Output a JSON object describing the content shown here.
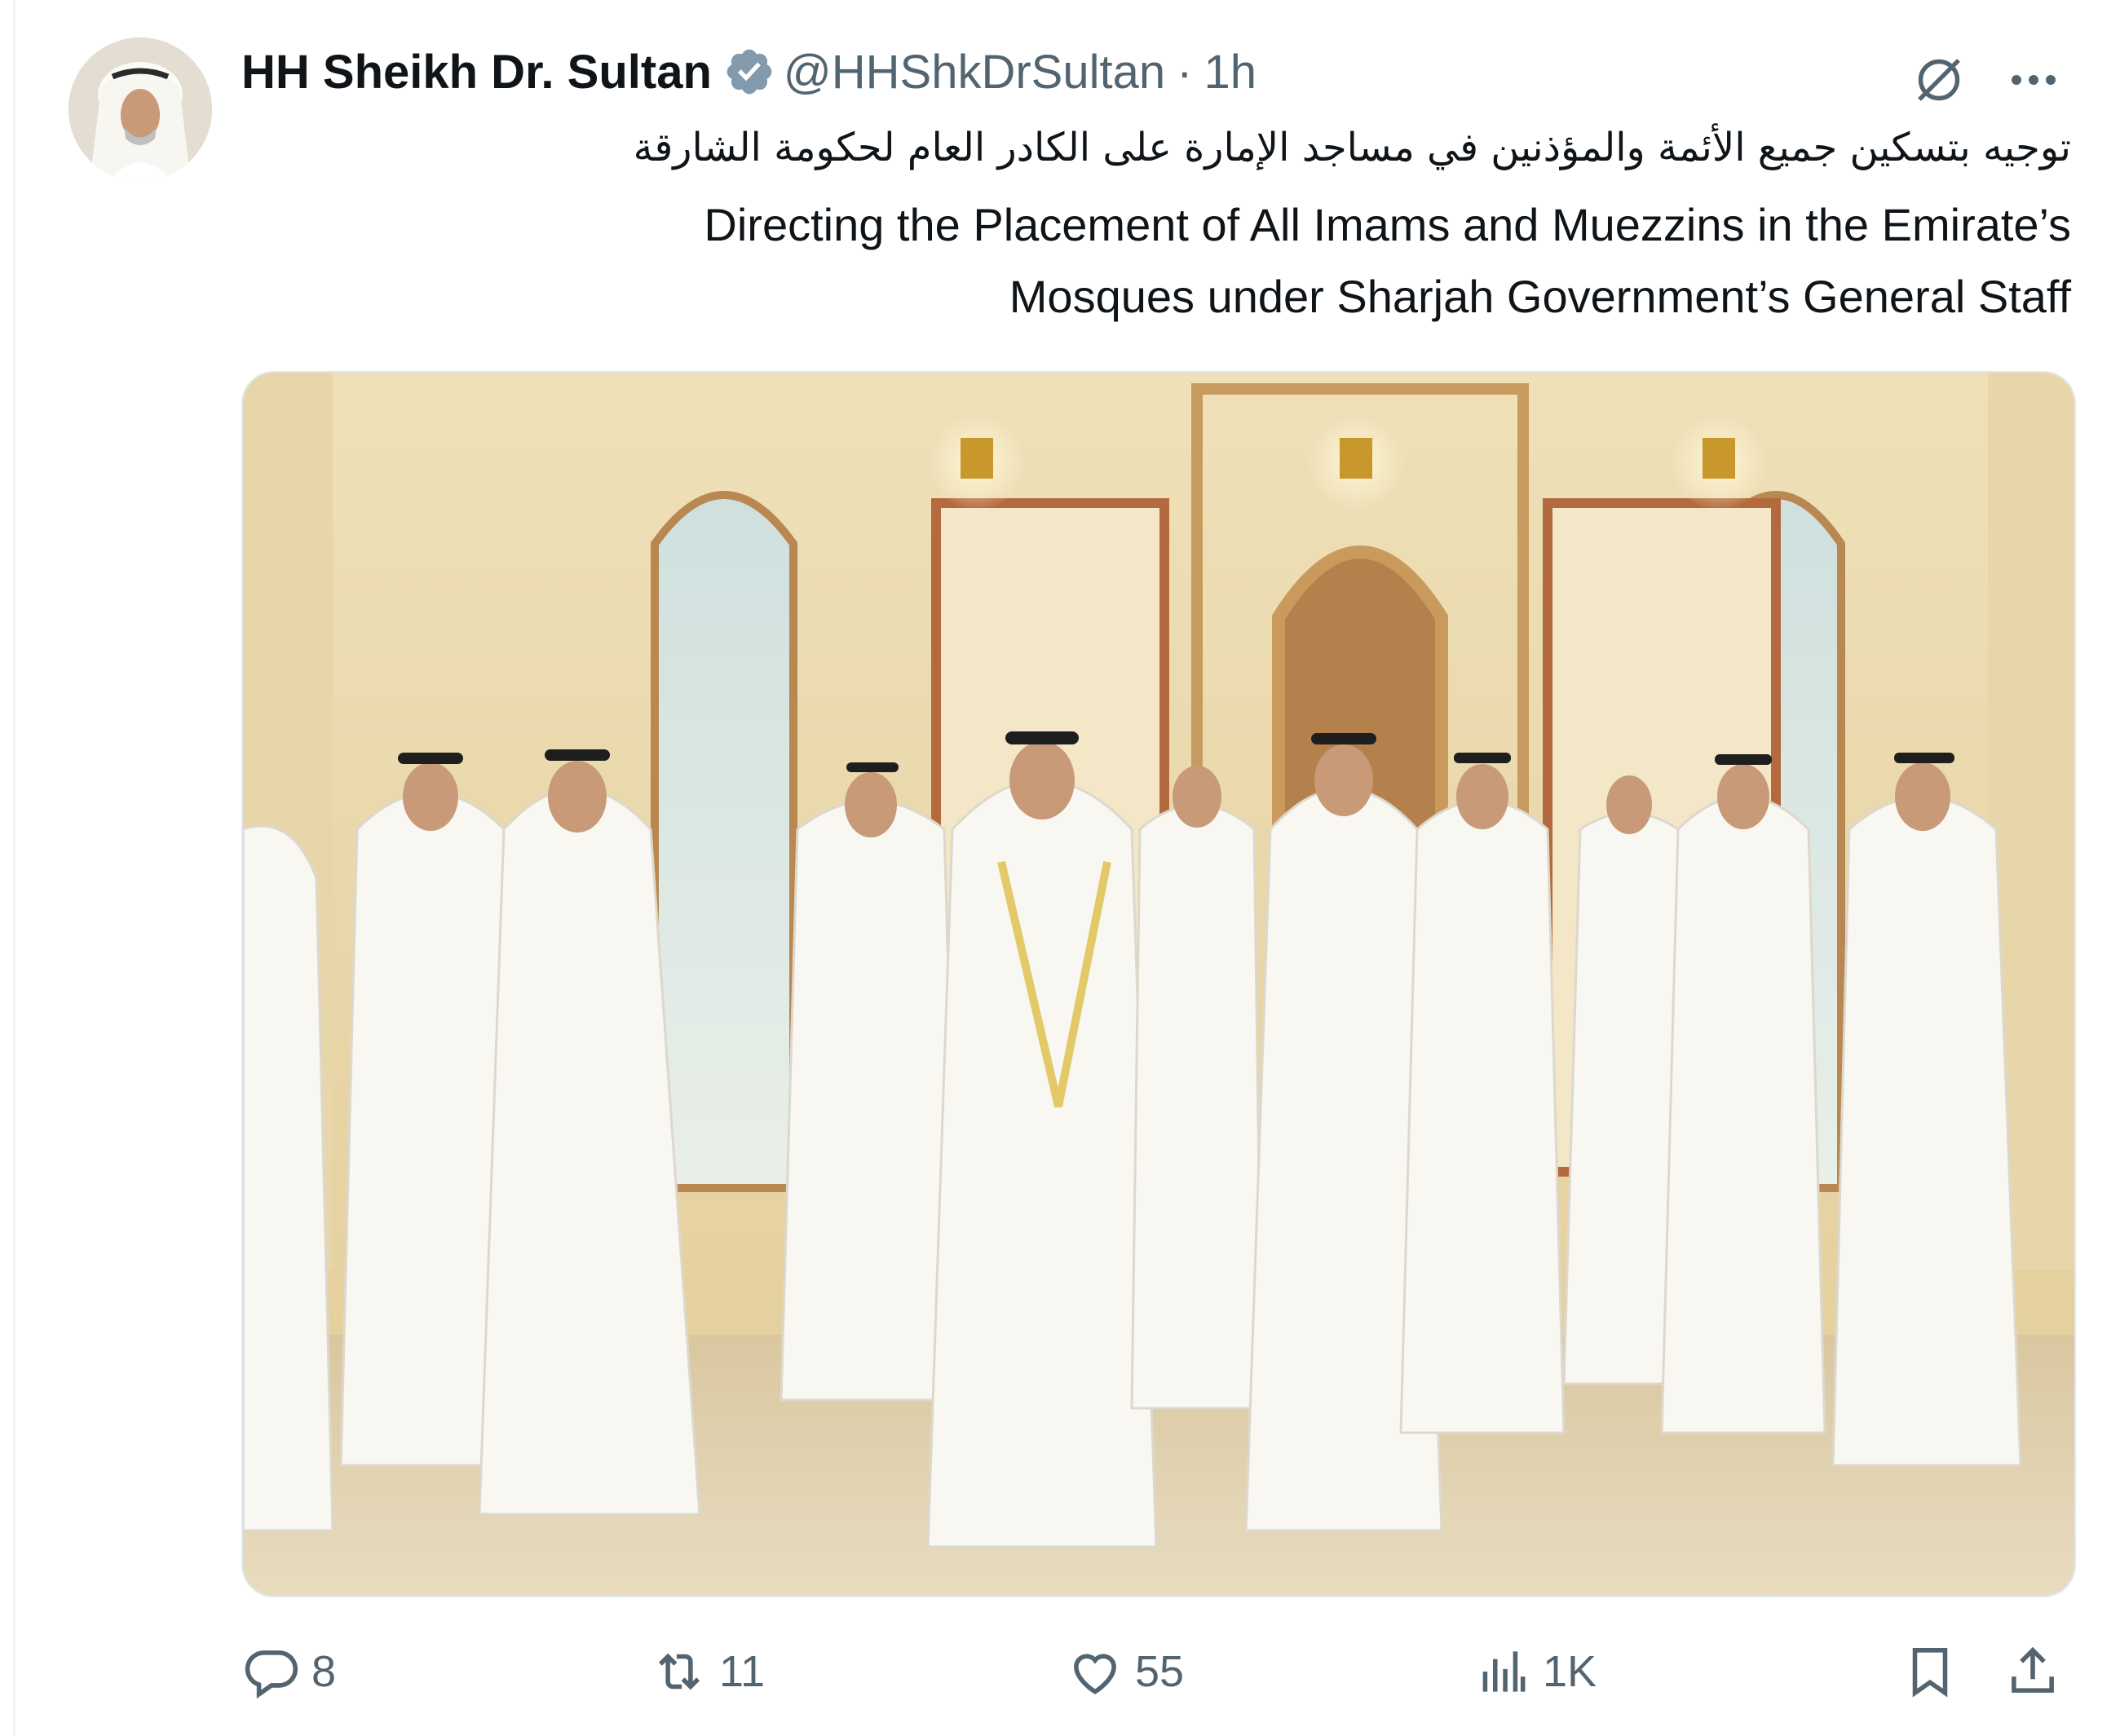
{
  "tweet": {
    "author": {
      "display_name": "HH Sheikh Dr. Sultan",
      "handle": "@HHShkDrSultan",
      "separator": "·",
      "time": "1h",
      "verified_color": "#829aab"
    },
    "text_arabic": "توجيه بتسكين جميع الأئمة والمؤذنين في مساجد الإمارة على الكادر العام لحكومة الشارقة",
    "text_english_line1": "Directing the Placement of All Imams and Muezzins in the Emirate’s",
    "text_english_line2": "Mosques under Sharjah Government’s General Staff",
    "icons": {
      "grok": "grok-icon",
      "more": "more-icon"
    },
    "actions": {
      "replies": {
        "icon": "reply-icon",
        "count": "8"
      },
      "reposts": {
        "icon": "repost-icon",
        "count": "11"
      },
      "likes": {
        "icon": "like-icon",
        "count": "55"
      },
      "views": {
        "icon": "views-icon",
        "count": "1K"
      },
      "bookmark": {
        "icon": "bookmark-icon"
      },
      "share": {
        "icon": "share-icon"
      }
    },
    "colors": {
      "text": "#0f1419",
      "secondary": "#536471",
      "photo_walls": "#e6d4a8",
      "robes": "#f8f7f2"
    }
  }
}
